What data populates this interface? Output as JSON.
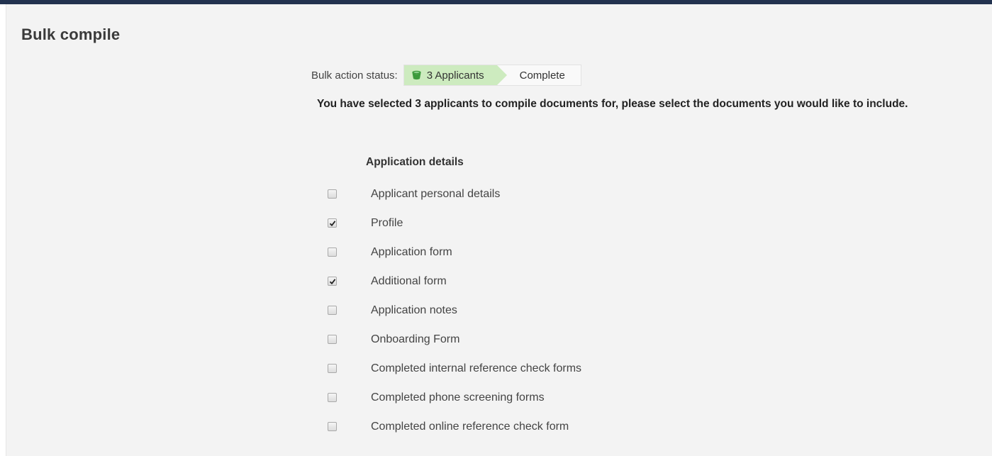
{
  "page": {
    "title": "Bulk compile"
  },
  "status": {
    "label": "Bulk action status:",
    "steps": [
      {
        "label": "3 Applicants",
        "state": "active",
        "icon": "bucket-icon"
      },
      {
        "label": "Complete",
        "state": "pending"
      }
    ]
  },
  "intro": "You have selected 3 applicants to compile documents for, please select the documents you would like to include.",
  "section": {
    "heading": "Application details",
    "options": [
      {
        "label": "Applicant personal details",
        "checked": false
      },
      {
        "label": "Profile",
        "checked": true
      },
      {
        "label": "Application form",
        "checked": false
      },
      {
        "label": "Additional form",
        "checked": true
      },
      {
        "label": "Application notes",
        "checked": false
      },
      {
        "label": "Onboarding Form",
        "checked": false
      },
      {
        "label": "Completed internal reference check forms",
        "checked": false
      },
      {
        "label": "Completed phone screening forms",
        "checked": false
      },
      {
        "label": "Completed online reference check form",
        "checked": false
      }
    ]
  },
  "colors": {
    "top_bar": "#22324f",
    "active_step": "#cdebbf",
    "icon_green": "#3c9a3c",
    "panel_bg": "#f3f3f3"
  }
}
